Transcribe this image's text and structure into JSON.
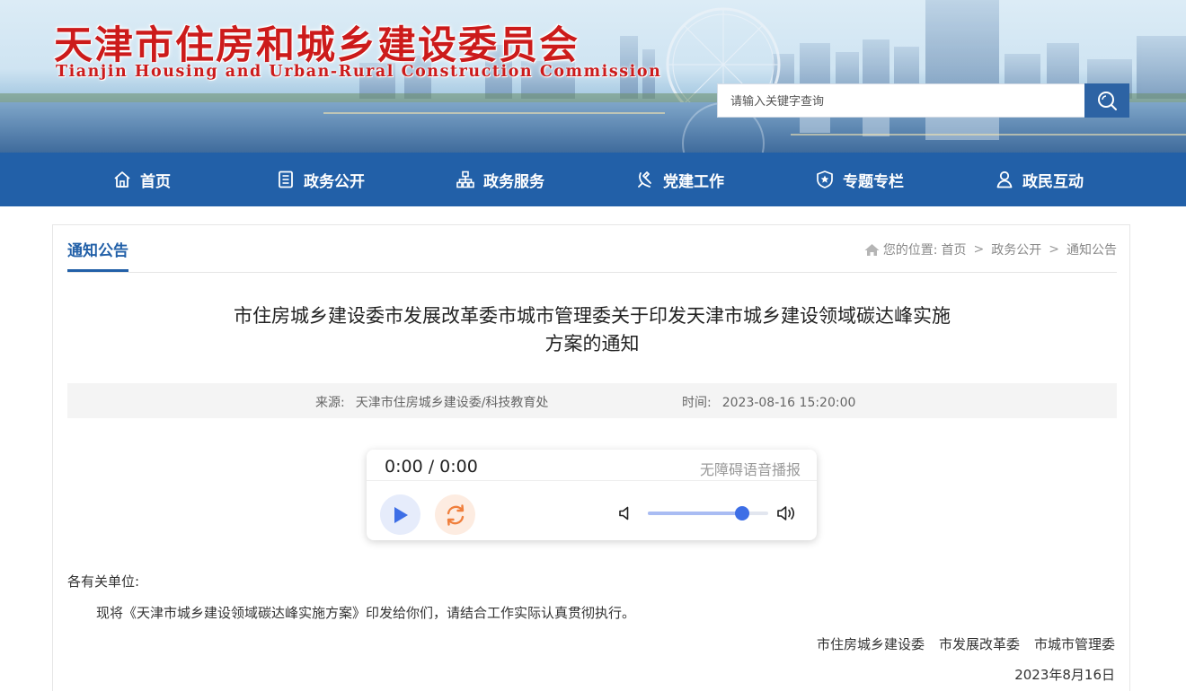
{
  "header": {
    "title_cn": "天津市住房和城乡建设委员会",
    "title_en": "Tianjin Housing and Urban-Rural Construction Commission",
    "search_placeholder": "请输入关键字查询",
    "search_icon": "search-icon"
  },
  "nav": {
    "items": [
      {
        "label": "首页",
        "icon": "home-icon"
      },
      {
        "label": "政务公开",
        "icon": "document-icon"
      },
      {
        "label": "政务服务",
        "icon": "org-chart-icon"
      },
      {
        "label": "党建工作",
        "icon": "party-emblem-icon"
      },
      {
        "label": "专题专栏",
        "icon": "shield-star-icon"
      },
      {
        "label": "政民互动",
        "icon": "user-icon"
      }
    ]
  },
  "section": {
    "tab": "通知公告",
    "breadcrumb_prefix": "您的位置:",
    "breadcrumb": [
      "首页",
      "政务公开",
      "通知公告"
    ],
    "breadcrumb_sep": ">"
  },
  "article": {
    "title_line1": "市住房城乡建设委市发展改革委市城市管理委关于印发天津市城乡建设领域碳达峰实施",
    "title_line2": "方案的通知",
    "source_label": "来源:",
    "source": "天津市住房城乡建设委/科技教育处",
    "time_label": "时间:",
    "time": "2023-08-16 15:20:00",
    "salutation": "各有关单位:",
    "paragraph": "现将《天津市城乡建设领域碳达峰实施方案》印发给你们，请结合工作实际认真贯彻执行。",
    "signers": [
      "市住房城乡建设委",
      "市发展改革委",
      "市城市管理委"
    ],
    "date": "2023年8月16日"
  },
  "player": {
    "time": "0:00 / 0:00",
    "label": "无障碍语音播报",
    "volume": 0.78,
    "colors": {
      "play": "#3d6ee6",
      "loop": "#f07f3c",
      "knob": "#3d6ee6"
    }
  },
  "colors": {
    "primary": "#2260a8",
    "title_red": "#cc1b1b"
  }
}
